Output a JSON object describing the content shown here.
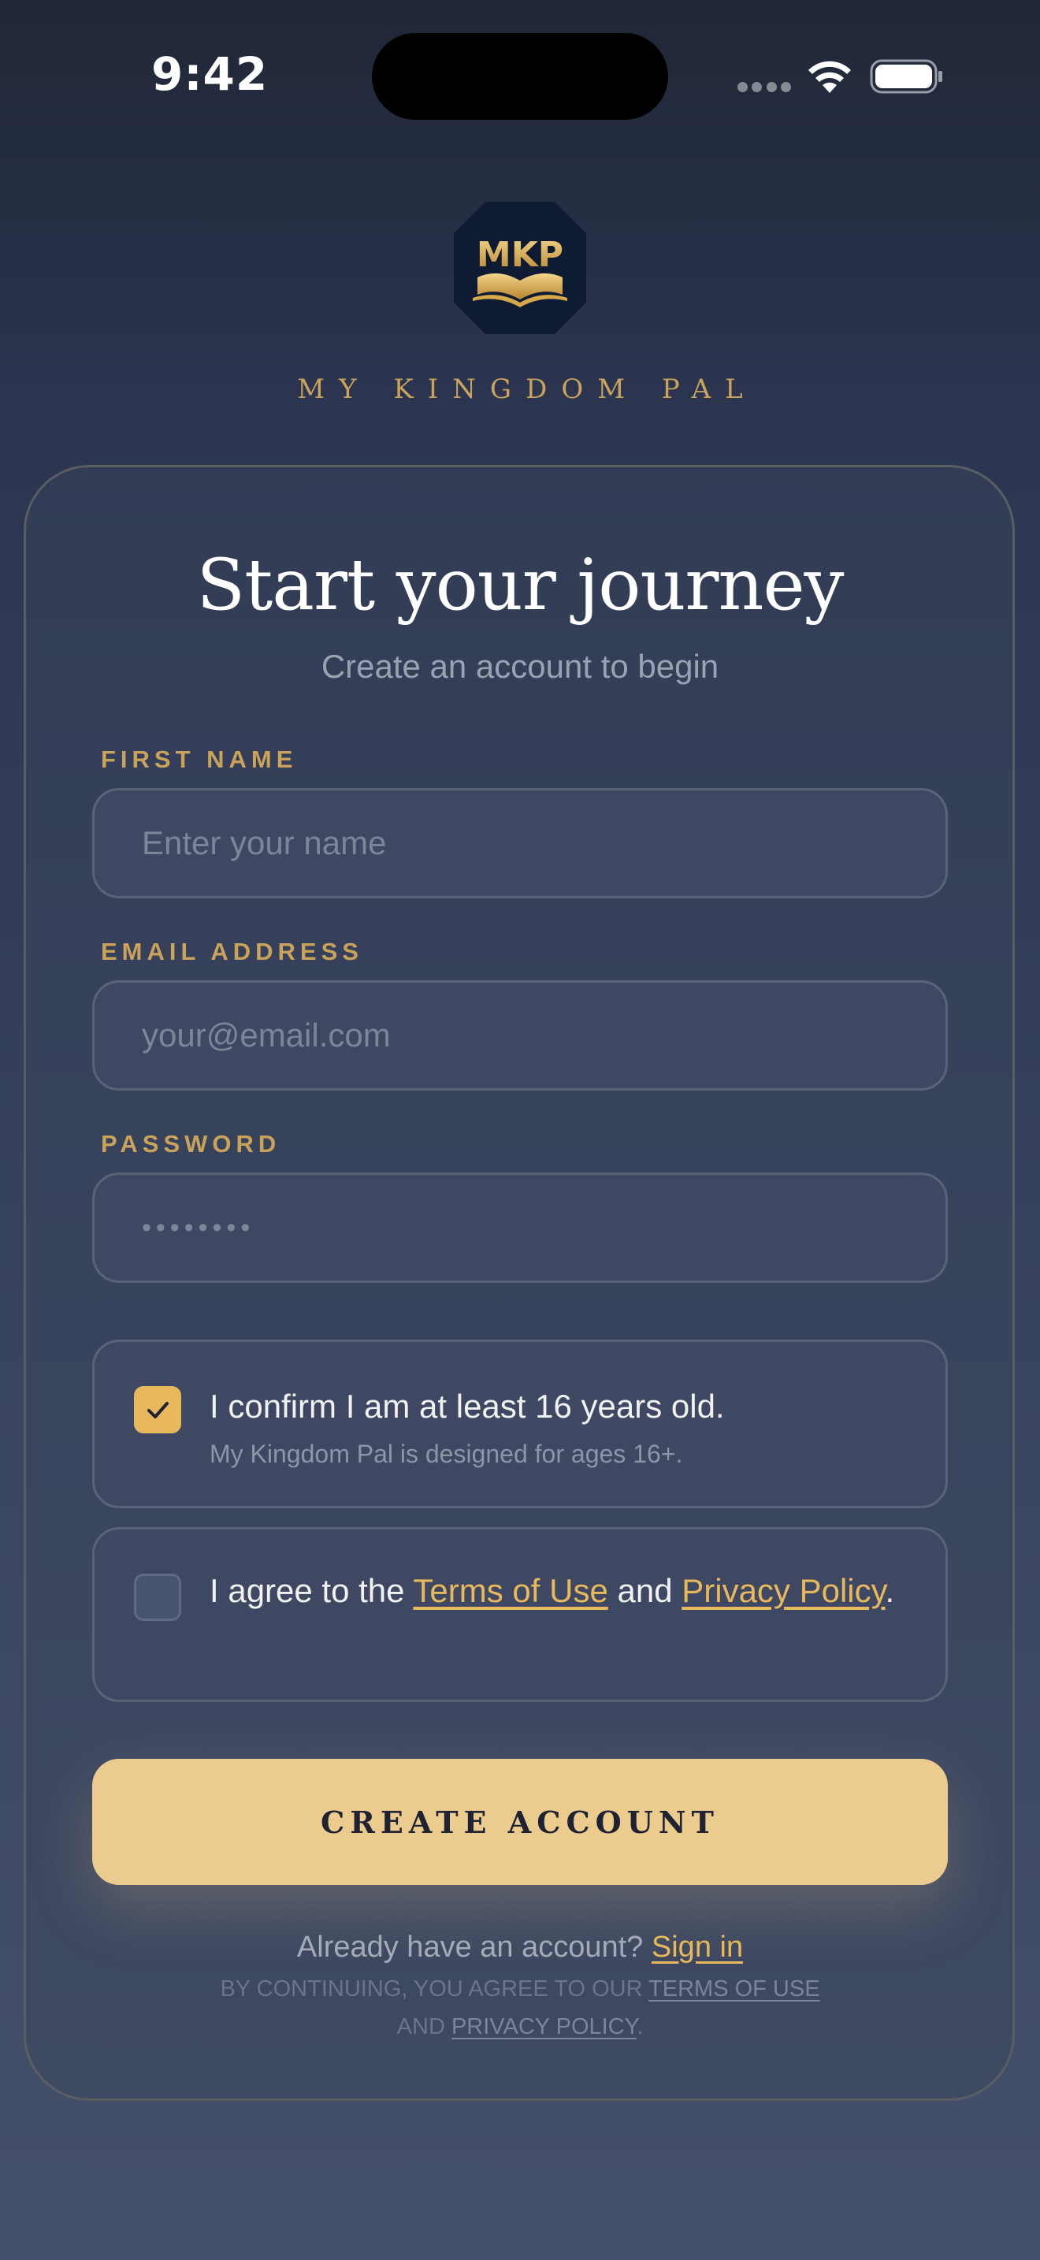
{
  "status_bar": {
    "time": "9:42"
  },
  "brand": {
    "logo_text": "MKP",
    "name": "MY KINGDOM PAL",
    "accent_color": "#c9a25c",
    "logo_background": "#0f1a33"
  },
  "form": {
    "title": "Start your journey",
    "subtitle": "Create an account to begin",
    "fields": {
      "first_name": {
        "label": "FIRST NAME",
        "placeholder": "Enter your name",
        "value": ""
      },
      "email": {
        "label": "EMAIL ADDRESS",
        "placeholder": "your@email.com",
        "value": ""
      },
      "password": {
        "label": "PASSWORD",
        "placeholder": "••••••••",
        "value": ""
      }
    },
    "age_confirm": {
      "checked": true,
      "text": "I confirm I am at least 16 years old.",
      "subtext": "My Kingdom Pal is designed for ages 16+."
    },
    "terms_agree": {
      "checked": false,
      "prefix": "I agree to the ",
      "terms_link": "Terms of Use",
      "middle": " and ",
      "privacy_link": "Privacy Policy",
      "suffix": "."
    },
    "submit_label": "CREATE ACCOUNT",
    "button_color": "#eccc8e"
  },
  "footer": {
    "signin_prompt": "Already have an account? ",
    "signin_link": "Sign in",
    "legal_prefix": "BY CONTINUING, YOU AGREE TO OUR ",
    "legal_terms": "TERMS OF USE",
    "legal_and": "AND ",
    "legal_privacy": "PRIVACY POLICY",
    "legal_suffix": "."
  }
}
